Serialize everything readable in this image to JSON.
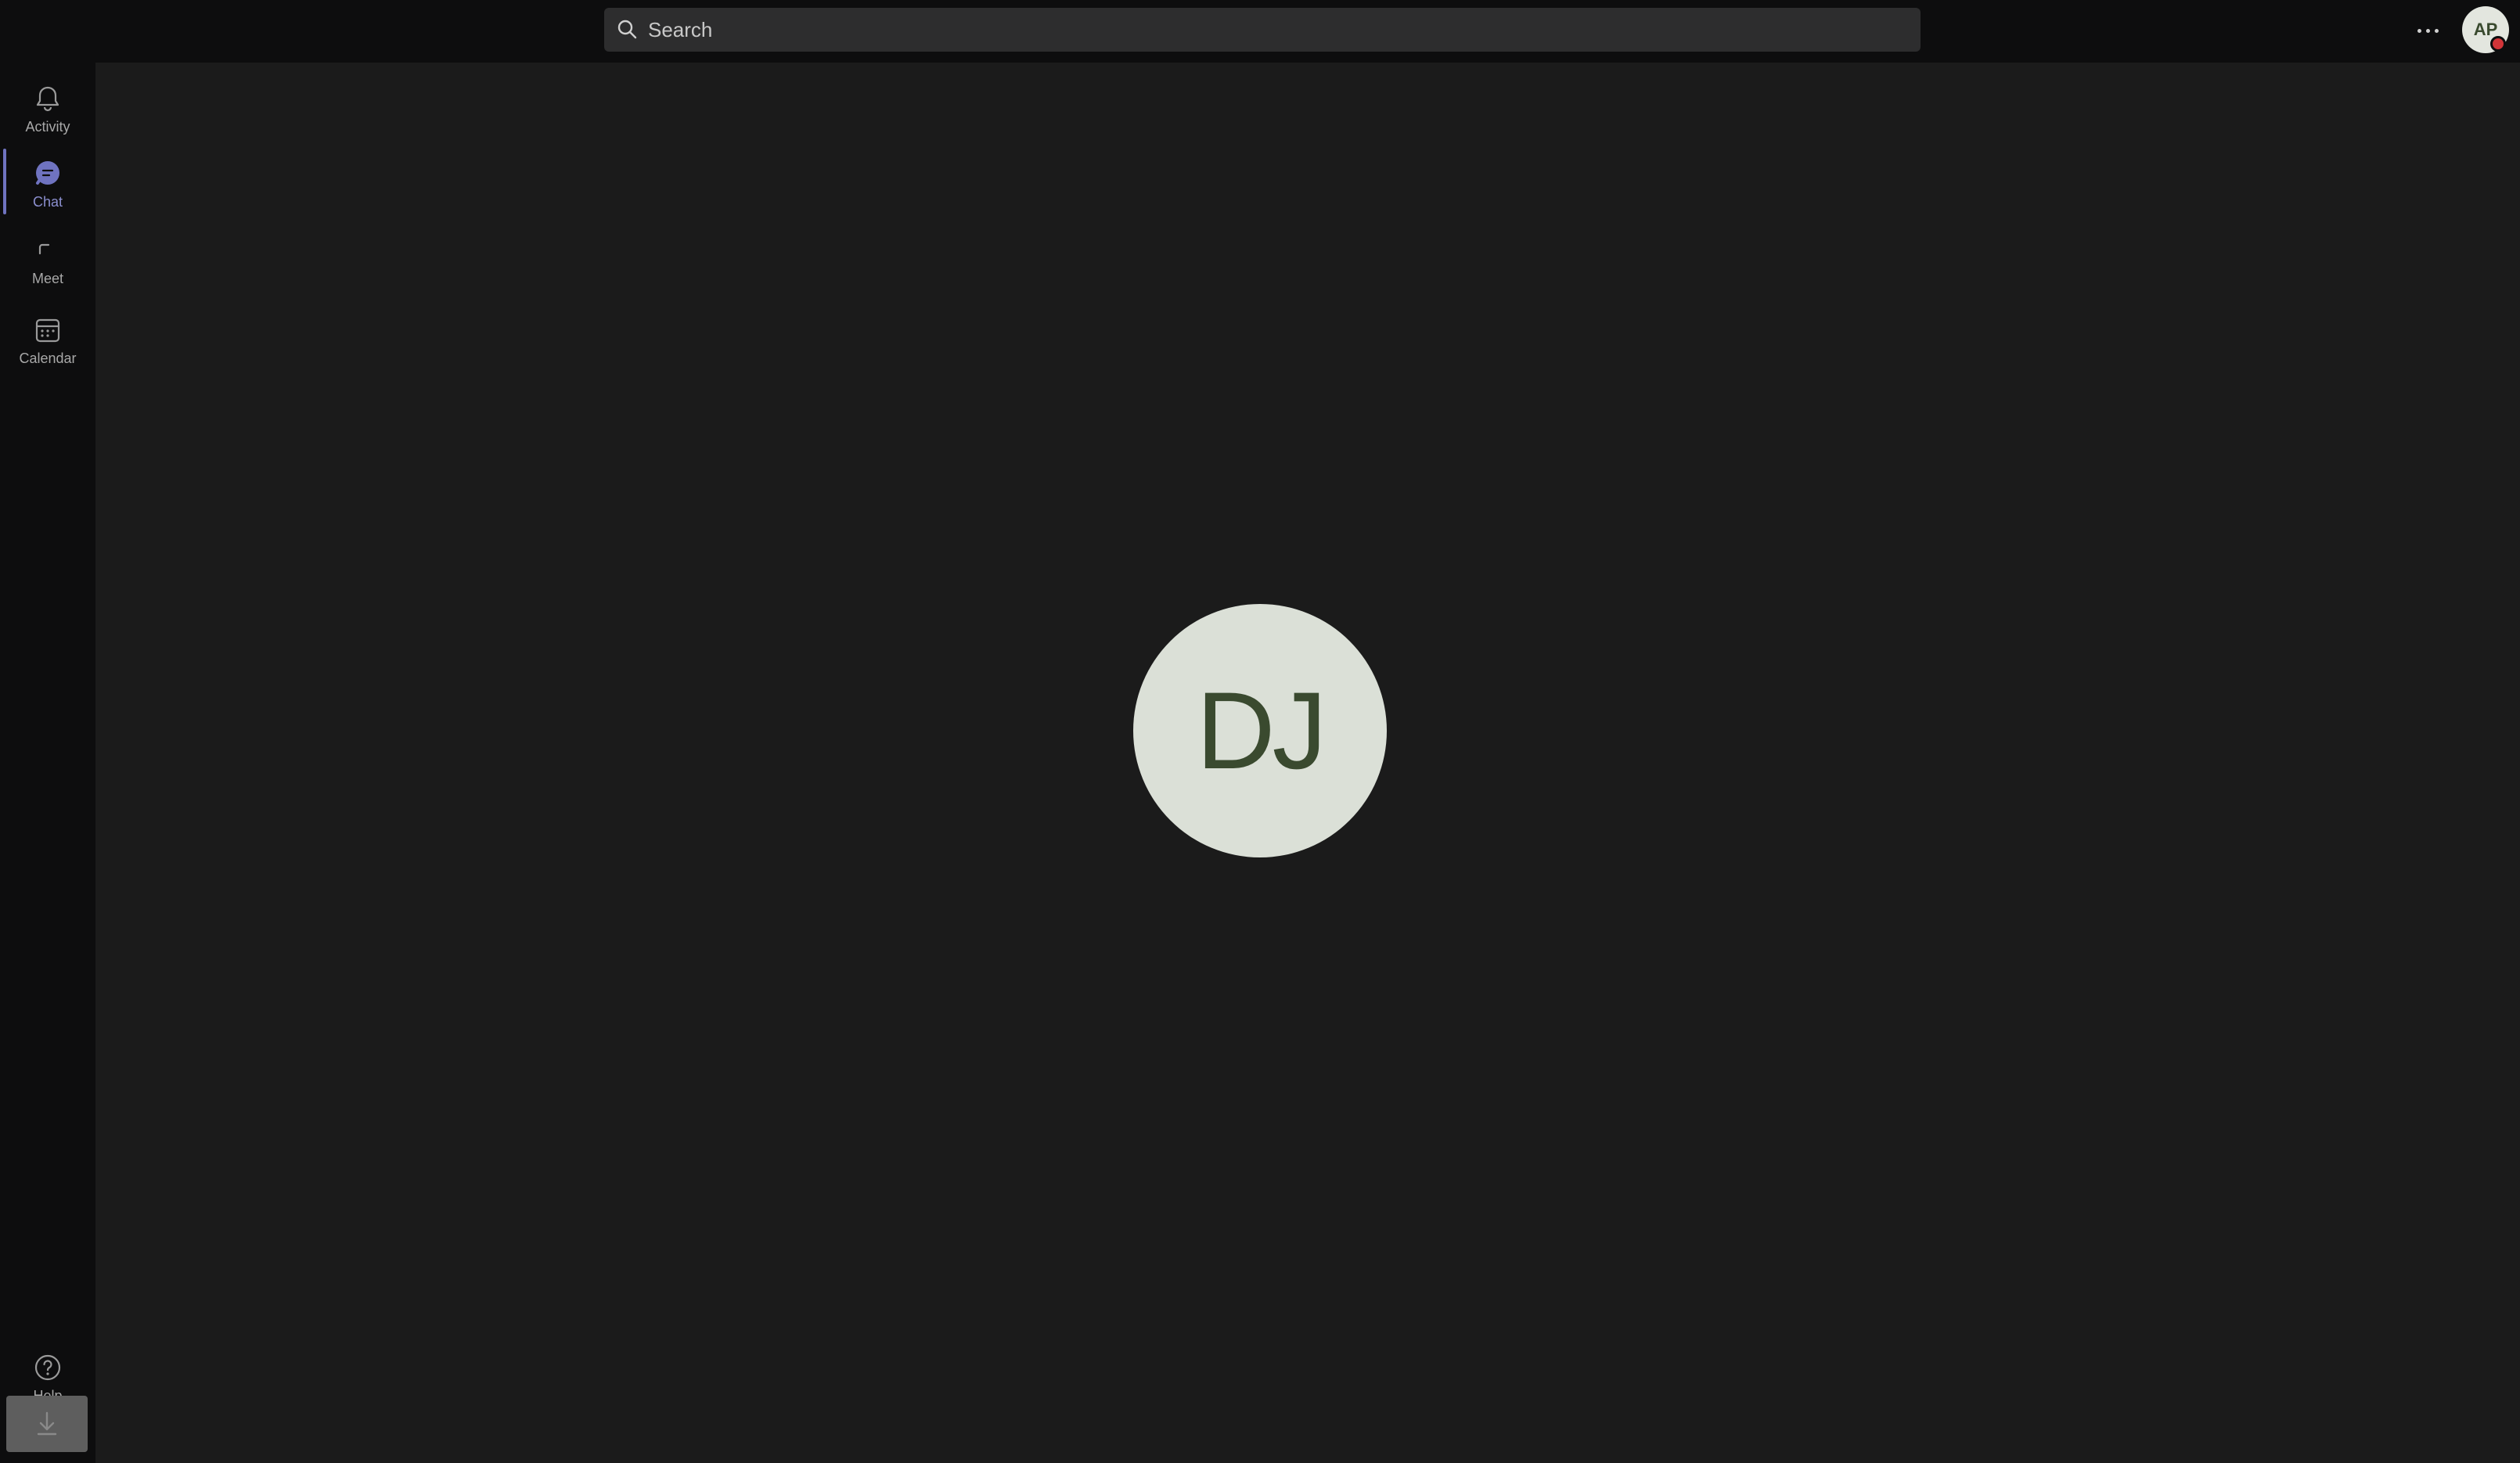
{
  "search": {
    "placeholder": "Search"
  },
  "header": {
    "more_icon": "more-horizontal-icon",
    "user_initials": "AP",
    "presence_color": "#d13438"
  },
  "rail": {
    "items": [
      {
        "label": "Activity",
        "icon": "bell-icon",
        "active": false
      },
      {
        "label": "Chat",
        "icon": "chat-icon",
        "active": true
      },
      {
        "label": "Meet",
        "icon": "video-icon",
        "active": false
      },
      {
        "label": "Calendar",
        "icon": "calendar-icon",
        "active": false
      }
    ],
    "help": {
      "label": "Help",
      "icon": "help-icon"
    },
    "download": {
      "icon": "download-icon"
    }
  },
  "call": {
    "participant_initials": "DJ"
  },
  "colors": {
    "accent": "#6f73c0",
    "background": "#1b1b1b",
    "rail": "#0d0d0e"
  }
}
